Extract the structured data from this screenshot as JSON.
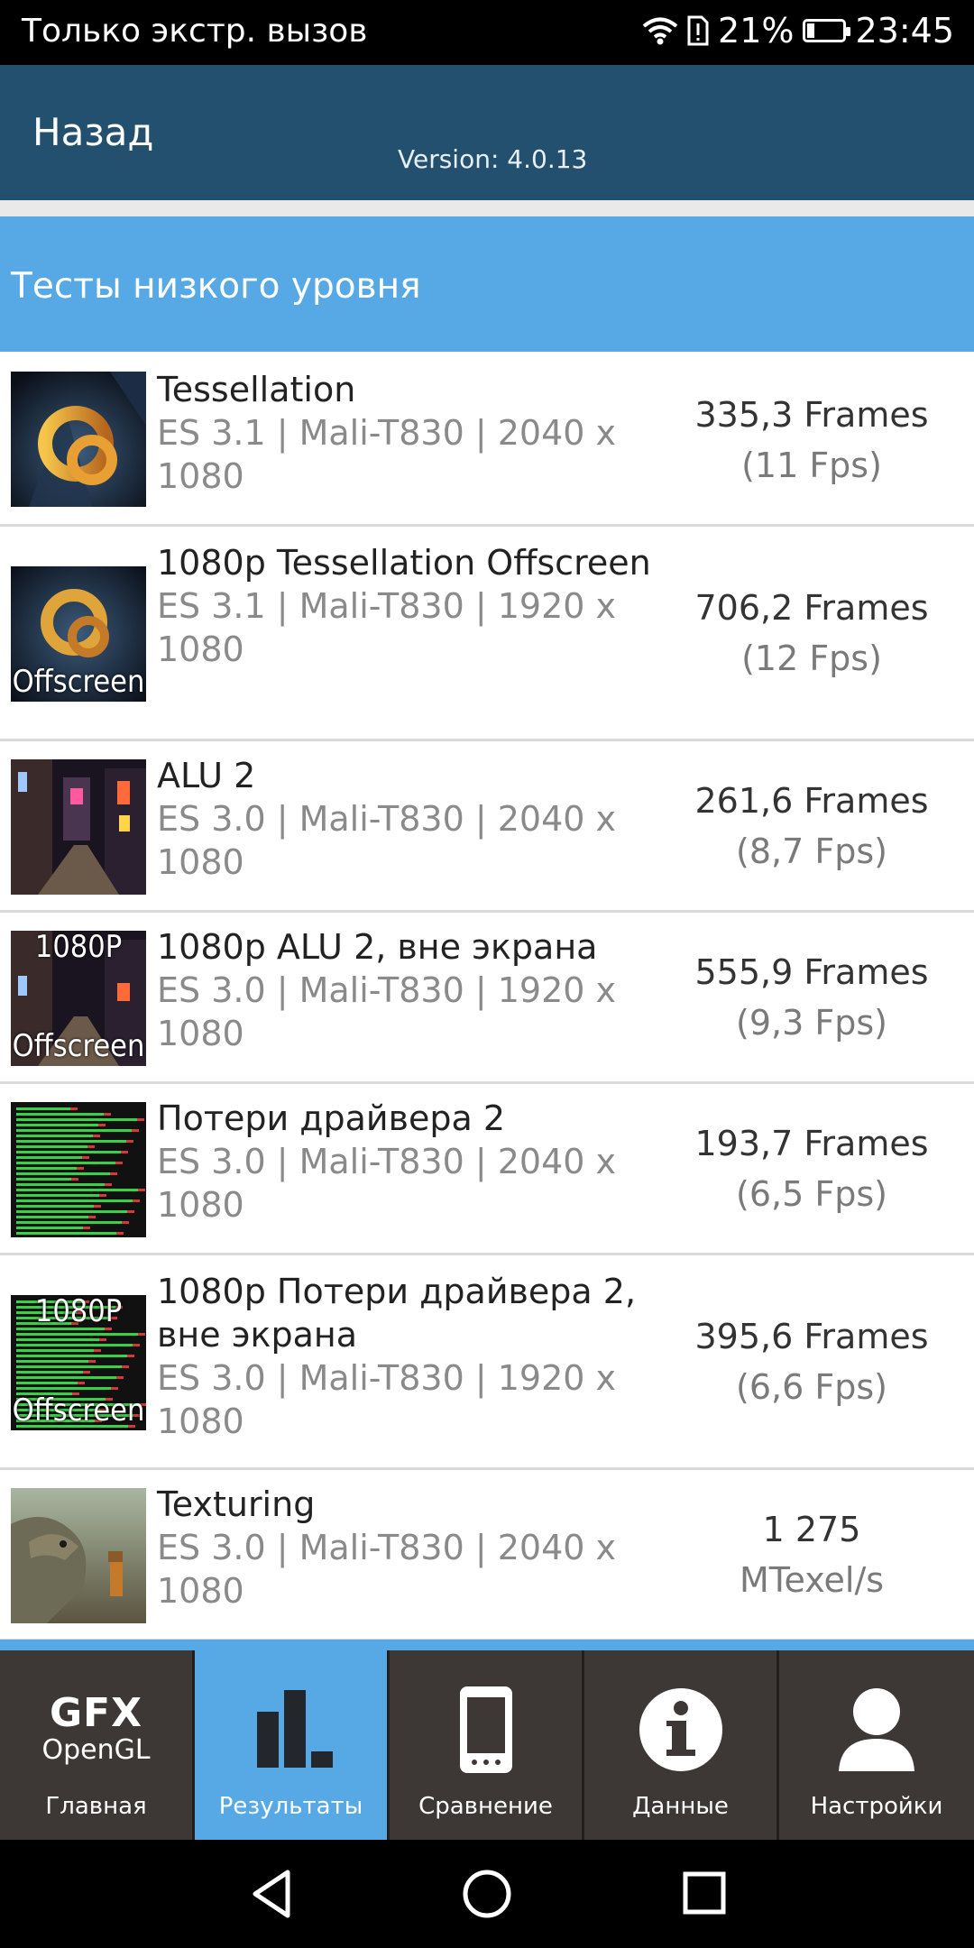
{
  "status_bar": {
    "carrier": "Только экстр. вызов",
    "battery_percent": "21%",
    "battery_level": 0.21,
    "time": "23:45"
  },
  "app_bar": {
    "back_label": "Назад",
    "version": "Version: 4.0.13"
  },
  "section": {
    "title": "Тесты низкого уровня"
  },
  "tests": [
    {
      "title": "Tessellation",
      "subtitle": "ES 3.1 | Mali-T830 | 2040 x 1080",
      "value": "335,3 Frames",
      "unit": "(11 Fps)",
      "badge_top": "",
      "badge_bottom": ""
    },
    {
      "title": "1080p Tessellation Offscreen",
      "subtitle": "ES 3.1 | Mali-T830 | 1920 x 1080",
      "value": "706,2 Frames",
      "unit": "(12 Fps)",
      "badge_top": "",
      "badge_bottom": "Offscreen"
    },
    {
      "title": "ALU 2",
      "subtitle": "ES 3.0 | Mali-T830 | 2040 x 1080",
      "value": "261,6 Frames",
      "unit": "(8,7 Fps)",
      "badge_top": "",
      "badge_bottom": ""
    },
    {
      "title": "1080p ALU 2, вне экрана",
      "subtitle": "ES 3.0 | Mali-T830 | 1920 x 1080",
      "value": "555,9 Frames",
      "unit": "(9,3 Fps)",
      "badge_top": "1080P",
      "badge_bottom": "Offscreen"
    },
    {
      "title": "Потери драйвера 2",
      "subtitle": "ES 3.0 | Mali-T830 | 2040 x 1080",
      "value": "193,7 Frames",
      "unit": "(6,5 Fps)",
      "badge_top": "",
      "badge_bottom": ""
    },
    {
      "title": "1080p Потери драйвера 2, вне экрана",
      "subtitle": "ES 3.0 | Mali-T830 | 1920 x 1080",
      "value": "395,6 Frames",
      "unit": "(6,6 Fps)",
      "badge_top": "1080P",
      "badge_bottom": "Offscreen"
    },
    {
      "title": "Texturing",
      "subtitle": "ES 3.0 | Mali-T830 | 2040 x 1080",
      "value": "1 275",
      "unit": "MTexel/s",
      "badge_top": "",
      "badge_bottom": ""
    }
  ],
  "bottom_nav": {
    "logo_top": "GFX",
    "logo_bottom": "OpenGL",
    "items": [
      {
        "label": "Главная",
        "icon": "gfx-logo-icon"
      },
      {
        "label": "Результаты",
        "icon": "bar-chart-icon"
      },
      {
        "label": "Сравнение",
        "icon": "phone-icon"
      },
      {
        "label": "Данные",
        "icon": "info-icon"
      },
      {
        "label": "Настройки",
        "icon": "person-icon"
      }
    ]
  },
  "colors": {
    "app_bar": "#24506f",
    "accent_blue": "#56a9e4",
    "nav_bg": "#3d3835"
  }
}
